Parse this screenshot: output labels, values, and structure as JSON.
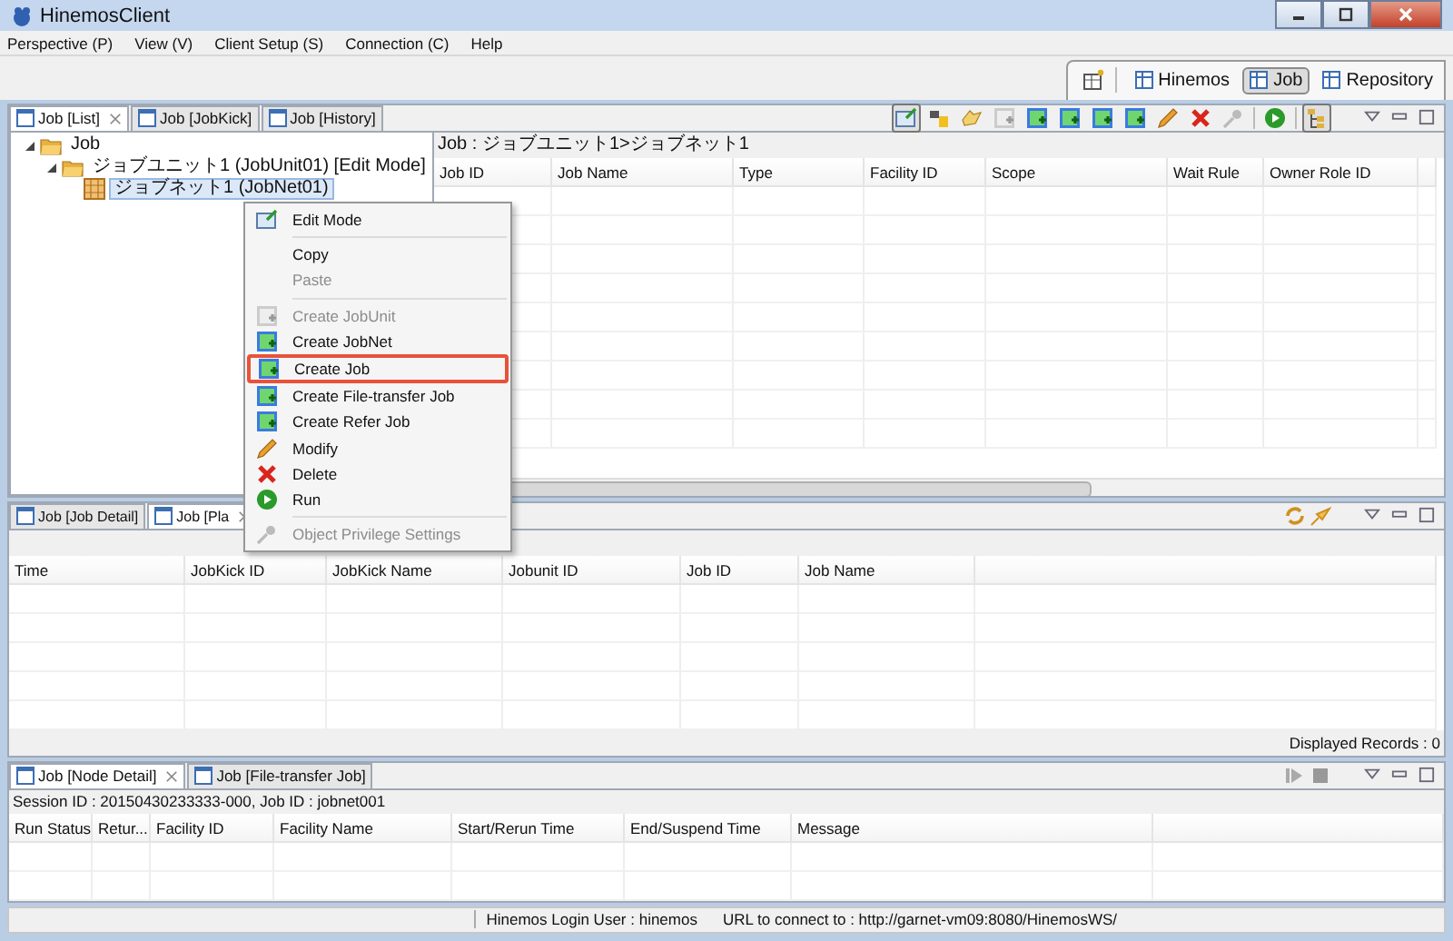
{
  "window": {
    "title": "HinemosClient"
  },
  "menu_bar": [
    "Perspective (P)",
    "View (V)",
    "Client Setup (S)",
    "Connection (C)",
    "Help"
  ],
  "perspectives": [
    {
      "label": "Hinemos",
      "selected": false
    },
    {
      "label": "Job",
      "selected": true
    },
    {
      "label": "Repository",
      "selected": false
    }
  ],
  "top_view": {
    "tabs": [
      {
        "label": "Job [List]",
        "selected": true
      },
      {
        "label": "Job [JobKick]",
        "selected": false
      },
      {
        "label": "Job [History]",
        "selected": false
      }
    ],
    "tree": {
      "label": "Job",
      "expanded": true,
      "selected": false,
      "children": [
        {
          "label": "ジョブユニット1 (JobUnit01) [Edit Mode]",
          "expanded": true,
          "selected": false,
          "children": [
            {
              "label": "ジョブネット1 (JobNet01)",
              "selected": true
            }
          ]
        }
      ]
    },
    "breadcrumb": "Job : ジョブユニット1>ジョブネット1",
    "columns": [
      "Job ID",
      "Job Name",
      "Type",
      "Facility ID",
      "Scope",
      "Wait Rule",
      "Owner Role ID"
    ]
  },
  "context_menu": {
    "items": [
      {
        "kind": "item",
        "label": "Edit Mode",
        "disabled": false,
        "highlighted": false
      },
      {
        "kind": "separator"
      },
      {
        "kind": "item",
        "label": "Copy",
        "disabled": false,
        "highlighted": false
      },
      {
        "kind": "item",
        "label": "Paste",
        "disabled": true,
        "highlighted": false
      },
      {
        "kind": "separator"
      },
      {
        "kind": "item",
        "label": "Create JobUnit",
        "disabled": true,
        "highlighted": false
      },
      {
        "kind": "item",
        "label": "Create JobNet",
        "disabled": false,
        "highlighted": false
      },
      {
        "kind": "item",
        "label": "Create Job",
        "disabled": false,
        "highlighted": true
      },
      {
        "kind": "item",
        "label": "Create File-transfer Job",
        "disabled": false,
        "highlighted": false
      },
      {
        "kind": "item",
        "label": "Create Refer Job",
        "disabled": false,
        "highlighted": false
      },
      {
        "kind": "item",
        "label": "Modify",
        "disabled": false,
        "highlighted": false
      },
      {
        "kind": "item",
        "label": "Delete",
        "disabled": false,
        "highlighted": false
      },
      {
        "kind": "item",
        "label": "Run",
        "disabled": false,
        "highlighted": false
      },
      {
        "kind": "separator"
      },
      {
        "kind": "item",
        "label": "Object Privilege Settings",
        "disabled": true,
        "highlighted": false
      }
    ]
  },
  "middle_view": {
    "tabs": [
      {
        "label": "Job [Job Detail]",
        "selected": false
      },
      {
        "label": "Job [Pla",
        "selected": true
      }
    ],
    "columns": [
      "Time",
      "JobKick ID",
      "JobKick Name",
      "Jobunit ID",
      "Job ID",
      "Job Name"
    ],
    "records": "Displayed Records : 0"
  },
  "bottom_view": {
    "tabs": [
      {
        "label": "Job [Node Detail]",
        "selected": true
      },
      {
        "label": "Job [File-transfer Job]",
        "selected": false
      }
    ],
    "info": "Session ID : 20150430233333-000,  Job ID : jobnet001",
    "columns": [
      "Run Status",
      "Retur...",
      "Facility ID",
      "Facility Name",
      "Start/Rerun Time",
      "End/Suspend Time",
      "Message"
    ]
  },
  "status_bar": {
    "login": "Hinemos Login User : hinemos",
    "url": "URL to connect to : http://garnet-vm09:8080/HinemosWS/"
  }
}
